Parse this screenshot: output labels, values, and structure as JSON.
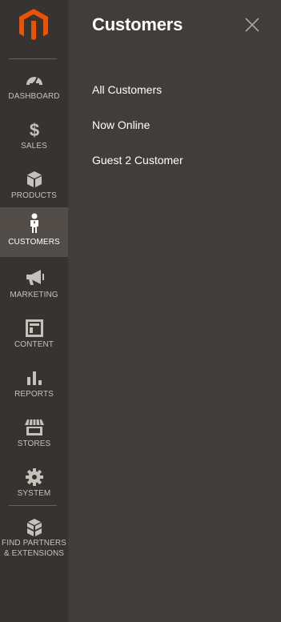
{
  "brand": {
    "accent": "#eb5202",
    "sidebar_bg": "#373330",
    "panel_bg": "#413d3a"
  },
  "logo": {
    "icon": "magento-logo-icon"
  },
  "nav": {
    "items": [
      {
        "label": "DASHBOARD",
        "icon": "dashboard-icon",
        "active": false
      },
      {
        "label": "SALES",
        "icon": "dollar-icon",
        "active": false
      },
      {
        "label": "PRODUCTS",
        "icon": "cube-icon",
        "active": false
      },
      {
        "label": "CUSTOMERS",
        "icon": "person-icon",
        "active": true
      },
      {
        "label": "MARKETING",
        "icon": "megaphone-icon",
        "active": false
      },
      {
        "label": "CONTENT",
        "icon": "layout-icon",
        "active": false
      },
      {
        "label": "REPORTS",
        "icon": "bar-chart-icon",
        "active": false
      },
      {
        "label": "STORES",
        "icon": "storefront-icon",
        "active": false
      },
      {
        "label": "SYSTEM",
        "icon": "gear-icon",
        "active": false
      },
      {
        "label_line1": "FIND PARTNERS",
        "label_line2": "& EXTENSIONS",
        "icon": "extension-blocks-icon",
        "active": false
      }
    ]
  },
  "panel": {
    "title": "Customers",
    "close_icon": "close-icon",
    "links": [
      {
        "label": "All Customers"
      },
      {
        "label": "Now Online"
      },
      {
        "label": "Guest 2 Customer"
      }
    ]
  }
}
